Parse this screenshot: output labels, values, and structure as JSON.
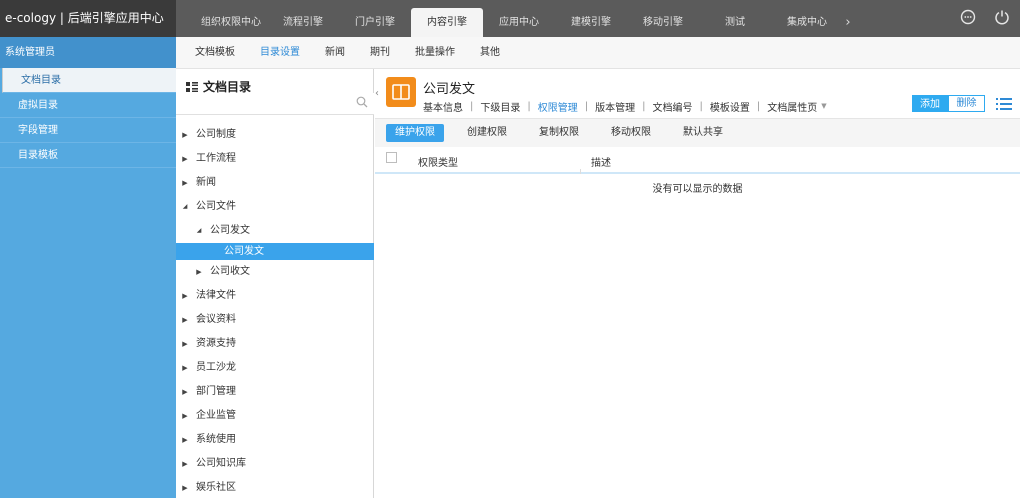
{
  "brand": {
    "title": "e-cology | 后端引擎应用中心"
  },
  "top_tabs": [
    {
      "label": "组织权限中心",
      "active": false
    },
    {
      "label": "流程引擎",
      "active": false
    },
    {
      "label": "门户引擎",
      "active": false
    },
    {
      "label": "内容引擎",
      "active": true
    },
    {
      "label": "应用中心",
      "active": false
    },
    {
      "label": "建模引擎",
      "active": false
    },
    {
      "label": "移动引擎",
      "active": false
    },
    {
      "label": "测试",
      "active": false
    },
    {
      "label": "集成中心",
      "active": false
    }
  ],
  "top_more": "›",
  "top_icons": [
    "minus-circle-icon",
    "power-icon"
  ],
  "leftnav": {
    "header": "系统管理员",
    "items": [
      {
        "label": "文档目录",
        "active": true
      },
      {
        "label": "虚拟目录",
        "active": false
      },
      {
        "label": "字段管理",
        "active": false
      },
      {
        "label": "目录模板",
        "active": false
      }
    ]
  },
  "subnav": [
    {
      "label": "文档模板",
      "active": false
    },
    {
      "label": "目录设置",
      "active": true
    },
    {
      "label": "新闻",
      "active": false
    },
    {
      "label": "期刊",
      "active": false
    },
    {
      "label": "批量操作",
      "active": false
    },
    {
      "label": "其他",
      "active": false
    }
  ],
  "tree": {
    "title": "文档目录",
    "search_placeholder": "",
    "nodes": [
      {
        "label": "公司制度",
        "level": 0,
        "state": "collapsed"
      },
      {
        "label": "工作流程",
        "level": 0,
        "state": "collapsed"
      },
      {
        "label": "新闻",
        "level": 0,
        "state": "collapsed"
      },
      {
        "label": "公司文件",
        "level": 0,
        "state": "expanded"
      },
      {
        "label": "公司发文",
        "level": 1,
        "state": "expanded"
      },
      {
        "label": "公司发文",
        "level": 2,
        "state": "leaf",
        "selected": true
      },
      {
        "label": "公司收文",
        "level": 1,
        "state": "collapsed"
      },
      {
        "label": "法律文件",
        "level": 0,
        "state": "collapsed"
      },
      {
        "label": "会议资料",
        "level": 0,
        "state": "collapsed"
      },
      {
        "label": "资源支持",
        "level": 0,
        "state": "collapsed"
      },
      {
        "label": "员工沙龙",
        "level": 0,
        "state": "collapsed"
      },
      {
        "label": "部门管理",
        "level": 0,
        "state": "collapsed"
      },
      {
        "label": "企业监管",
        "level": 0,
        "state": "collapsed"
      },
      {
        "label": "系统使用",
        "level": 0,
        "state": "collapsed"
      },
      {
        "label": "公司知识库",
        "level": 0,
        "state": "collapsed"
      },
      {
        "label": "娱乐社区",
        "level": 0,
        "state": "collapsed"
      }
    ]
  },
  "main": {
    "title": "公司发文",
    "tabs": [
      {
        "label": "基本信息",
        "active": false
      },
      {
        "label": "下级目录",
        "active": false
      },
      {
        "label": "权限管理",
        "active": true
      },
      {
        "label": "版本管理",
        "active": false
      },
      {
        "label": "文档编号",
        "active": false
      },
      {
        "label": "模板设置",
        "active": false
      },
      {
        "label": "文档属性页",
        "active": false,
        "dropdown": true
      }
    ],
    "add_label": "添加",
    "delete_label": "删除",
    "perm_buttons": [
      {
        "label": "维护权限",
        "active": true
      },
      {
        "label": "创建权限",
        "active": false
      },
      {
        "label": "复制权限",
        "active": false
      },
      {
        "label": "移动权限",
        "active": false
      },
      {
        "label": "默认共享",
        "active": false
      }
    ],
    "grid": {
      "columns": [
        "权限类型",
        "描述"
      ],
      "empty_text": "没有可以显示的数据"
    }
  },
  "colors": {
    "topbar": "#5b5b5b",
    "brand_bg": "#3a3a3a",
    "leftnav": "#55a9e0",
    "accent": "#2e8ad6",
    "selected": "#3aa3eb",
    "category_icon": "#f28c1b"
  }
}
